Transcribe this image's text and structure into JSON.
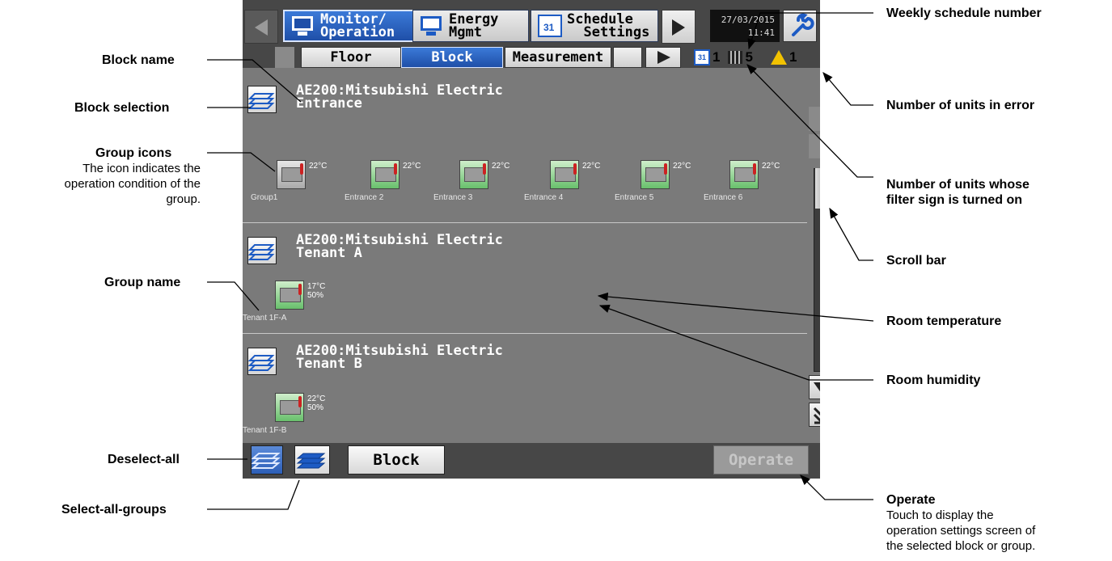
{
  "screen": {
    "tabs": [
      {
        "label": "Monitor/\nOperation"
      },
      {
        "label": "Energy\nMgmt"
      },
      {
        "label": "Schedule\n  Settings"
      }
    ],
    "datetime": {
      "date": "27/03/2015",
      "time": "11:41"
    },
    "subtabs": [
      "Floor",
      "Block",
      "Measurement"
    ],
    "status": {
      "schedule_no": "1",
      "filter_count": "5",
      "error_count": "1"
    },
    "blocks": [
      {
        "name": "AE200:Mitsubishi Electric\nEntrance",
        "groups": [
          {
            "name": "Group1",
            "temp": "22°C"
          },
          {
            "name": "Entrance 2",
            "temp": "22°C"
          },
          {
            "name": "Entrance 3",
            "temp": "22°C"
          },
          {
            "name": "Entrance 4",
            "temp": "22°C"
          },
          {
            "name": "Entrance 5",
            "temp": "22°C"
          },
          {
            "name": "Entrance 6",
            "temp": "22°C"
          }
        ]
      },
      {
        "name": "AE200:Mitsubishi Electric\nTenant A",
        "groups": [
          {
            "name": "Tenant 1F-A",
            "temp": "17°C",
            "humidity": "50%"
          }
        ]
      },
      {
        "name": "AE200:Mitsubishi Electric\nTenant B",
        "groups": [
          {
            "name": "Tenant 1F-B",
            "temp": "22°C",
            "humidity": "50%"
          }
        ]
      }
    ],
    "bottom": {
      "block_button": "Block",
      "operate_button": "Operate"
    }
  },
  "callouts": {
    "block_name": "Block name",
    "block_selection": "Block selection",
    "group_icons": "Group icons",
    "group_icons_desc_1": "The icon indicates the",
    "group_icons_desc_2": "operation condition of the",
    "group_icons_desc_3": "group.",
    "group_name": "Group name",
    "deselect_all": "Deselect-all",
    "select_all_groups": "Select-all-groups",
    "weekly_schedule": "Weekly schedule number",
    "units_in_error": "Number of units in error",
    "filter_sign_1": "Number of units whose",
    "filter_sign_2": "filter sign is turned on",
    "scroll_bar": "Scroll bar",
    "room_temp": "Room temperature",
    "room_humidity": "Room humidity",
    "operate": "Operate",
    "operate_desc_1": "Touch to display the",
    "operate_desc_2": "operation settings screen of",
    "operate_desc_3": "the selected block or group."
  },
  "colors": {
    "accent": "#1f4fa8",
    "screen_bg": "#7a7a7a",
    "bar_bg": "#474747"
  }
}
